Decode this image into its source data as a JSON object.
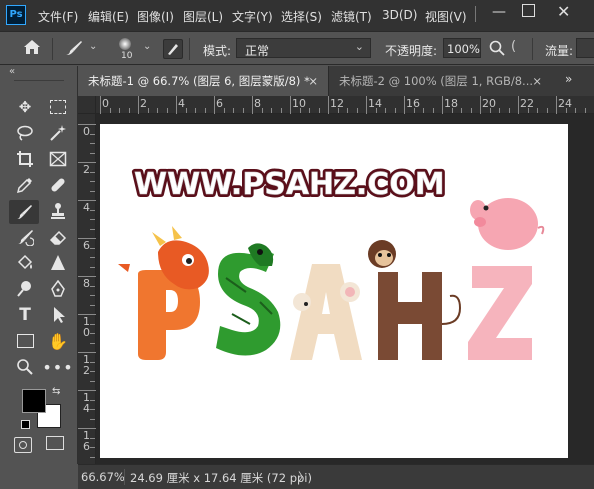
{
  "app": {
    "logo": "Ps"
  },
  "menu": [
    "文件(F)",
    "编辑(E)",
    "图像(I)",
    "图层(L)",
    "文字(Y)",
    "选择(S)",
    "滤镜(T)",
    "3D(D)",
    "视图(V)"
  ],
  "options": {
    "brush_size": "10",
    "mode_label": "模式:",
    "mode_value": "正常",
    "opacity_label": "不透明度:",
    "opacity_value": "100%",
    "flow_label": "流量:"
  },
  "tabs": [
    {
      "label": "未标题-1 @ 66.7% (图层 6, 图层蒙版/8) *",
      "active": true
    },
    {
      "label": "未标题-2 @ 100% (图层 1, RGB/8...",
      "active": false
    }
  ],
  "ruler_top": [
    "0",
    "2",
    "4",
    "6",
    "8",
    "10",
    "12",
    "14",
    "16",
    "18",
    "20",
    "22",
    "24"
  ],
  "ruler_left": [
    "0",
    "2",
    "4",
    "6",
    "8",
    "1",
    "1",
    "1",
    "1"
  ],
  "ruler_left_sub": [
    "",
    "",
    "",
    "",
    "",
    "0",
    "2",
    "4",
    "6"
  ],
  "canvas": {
    "headline": "WWW.PSAHZ.COM",
    "letters": [
      "P",
      "S",
      "A",
      "H",
      "Z"
    ],
    "letter_colors": [
      "#f0762f",
      "#2f9b2f",
      "#f1dcc2",
      "#7a4a34",
      "#f6b4bd"
    ]
  },
  "colors": {
    "foreground": "#000000",
    "background": "#ffffff"
  },
  "status": {
    "zoom": "66.67%",
    "doc_size": "24.69 厘米 x 17.64 厘米 (72 ppi)",
    "arrow": "〉"
  },
  "icons": {
    "home": "home-icon",
    "brush": "brush-icon",
    "search": "search-icon"
  }
}
